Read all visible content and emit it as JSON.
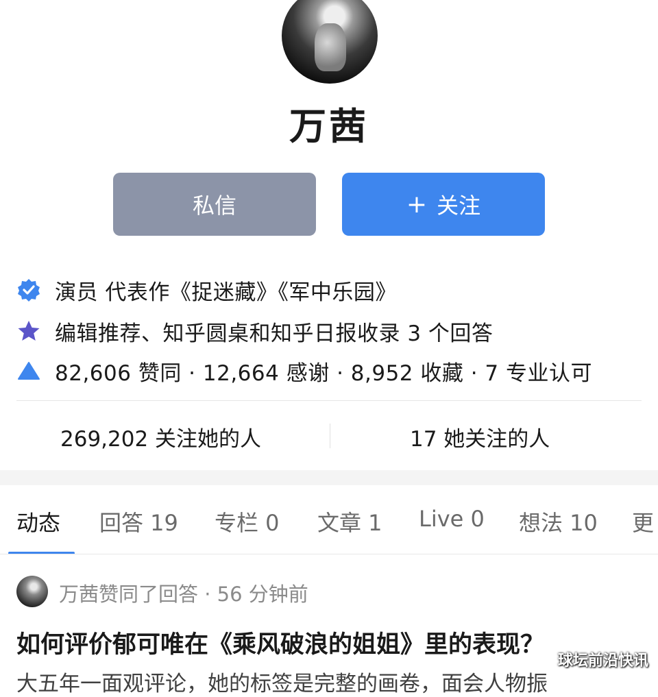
{
  "profile": {
    "name": "万茜",
    "buttons": {
      "message": "私信",
      "follow_plus": "+",
      "follow": "关注"
    }
  },
  "info": {
    "verified": "演员 代表作《捉迷藏》《军中乐园》",
    "recommend": "编辑推荐、知乎圆桌和知乎日报收录 3 个回答",
    "stats": "82,606 赞同 · 12,664 感谢 · 8,952 收藏 · 7 专业认可"
  },
  "follow_stats": {
    "followers": "269,202 关注她的人",
    "following": "17 她关注的人"
  },
  "tabs": [
    {
      "label": "动态"
    },
    {
      "label": "回答 19"
    },
    {
      "label": "专栏 0"
    },
    {
      "label": "文章 1"
    },
    {
      "label": "Live 0"
    },
    {
      "label": "想法 10"
    },
    {
      "label": "更"
    }
  ],
  "feed": {
    "meta": "万茜赞同了回答 · 56 分钟前",
    "title": "如何评价郁可唯在《乘风破浪的姐姐》里的表现？",
    "excerpt": "大五年一面观评论，她的标签是完整的画卷，面会人物振"
  },
  "watermark": "球坛前沿快讯",
  "icons": {
    "verified": "verified-badge-icon",
    "star": "star-icon",
    "triangle": "triangle-up-icon"
  },
  "colors": {
    "primary": "#3e86ee",
    "secondary_button": "#8c94a8",
    "star": "#5b55c9"
  }
}
